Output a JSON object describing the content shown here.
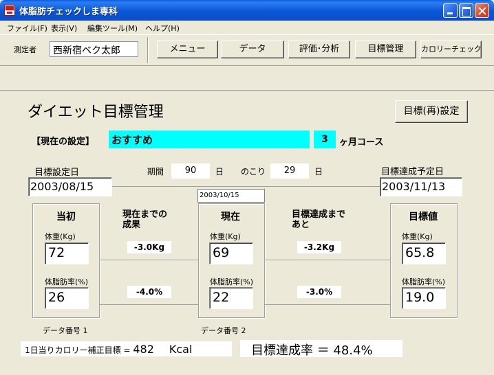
{
  "window": {
    "title": "体脂肪チェックしま専科"
  },
  "menu": {
    "items": [
      "ファイル(F)",
      "表示(V)",
      "編集ツール(M)",
      "ヘルプ(H)"
    ]
  },
  "toolbar": {
    "operator_label": "測定者",
    "operator_name": "西新宿ベク太郎",
    "buttons": [
      "メニュー",
      "データ",
      "評価･分析",
      "目標管理",
      "カロリーチェック"
    ]
  },
  "main": {
    "title": "ダイエット目標管理",
    "reset_button": "目標(再)設定",
    "current_setting_label": "【現在の設定】",
    "course_name": "おすすめ",
    "months": "3",
    "course_suffix": "ヶ月コース",
    "start_date_label": "目標設定日",
    "start_date": "2003/08/15",
    "period_label": "期間",
    "period_value": "90",
    "day_unit": "日",
    "remaining_label": "のこり",
    "remaining_value": "29",
    "target_date_label": "目標達成予定日",
    "target_date": "2003/11/13",
    "current_date": "2003/10/15"
  },
  "groups": {
    "initial": {
      "title": "当初",
      "weight_label": "体重(Kg)",
      "weight": "72",
      "fat_label": "体脂肪率(%)",
      "fat": "26",
      "data_number": "データ番号 1"
    },
    "current": {
      "title": "現在",
      "weight_label": "体重(Kg)",
      "weight": "69",
      "fat_label": "体脂肪率(%)",
      "fat": "22",
      "data_number": "データ番号 2"
    },
    "goal": {
      "title": "目標値",
      "weight_label": "体重(Kg)",
      "weight": "65.8",
      "fat_label": "体脂肪率(%)",
      "fat": "19.0"
    }
  },
  "progress": {
    "achieved_line1": "現在までの",
    "achieved_line2": "成果",
    "achieved_weight": "-3.0Kg",
    "achieved_fat": "-4.0%",
    "remaining_line1": "目標達成まで",
    "remaining_line2": "あと",
    "remaining_weight": "-3.2Kg",
    "remaining_fat": "-3.0%"
  },
  "footer": {
    "kcal_label": "1日当りカロリー補正目標 = ",
    "kcal_value": "482",
    "kcal_unit": "Kcal",
    "rate_text": "目標達成率 ＝ 48.4%"
  },
  "colors": {
    "highlight": "#00ffff",
    "titlebar": "#0a56d6",
    "face": "#ece9d8"
  }
}
